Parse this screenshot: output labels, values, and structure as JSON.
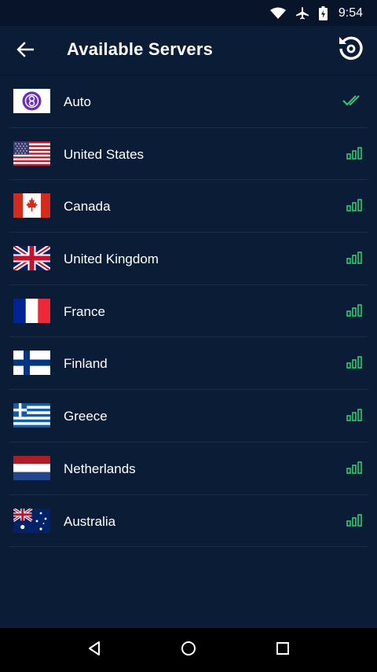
{
  "status_bar": {
    "time": "9:54",
    "icons": [
      "wifi-icon",
      "airplane-icon",
      "battery-icon"
    ]
  },
  "header": {
    "title": "Available Servers",
    "back_icon": "arrow-back-icon",
    "refresh_icon": "refresh-icon"
  },
  "colors": {
    "background": "#0b1c37",
    "status_bar": "#07142a",
    "divider": "#1a2c4b",
    "signal_green": "#2ecc71",
    "auto_badge": "#6b2fbd"
  },
  "servers": [
    {
      "name": "Auto",
      "flag": "auto",
      "indicator": "double-check-icon"
    },
    {
      "name": "United States",
      "flag": "us",
      "indicator": "signal-bars-icon"
    },
    {
      "name": "Canada",
      "flag": "ca",
      "indicator": "signal-bars-icon"
    },
    {
      "name": "United Kingdom",
      "flag": "gb",
      "indicator": "signal-bars-icon"
    },
    {
      "name": "France",
      "flag": "fr",
      "indicator": "signal-bars-icon"
    },
    {
      "name": "Finland",
      "flag": "fi",
      "indicator": "signal-bars-icon"
    },
    {
      "name": "Greece",
      "flag": "gr",
      "indicator": "signal-bars-icon"
    },
    {
      "name": "Netherlands",
      "flag": "nl",
      "indicator": "signal-bars-icon"
    },
    {
      "name": "Australia",
      "flag": "au",
      "indicator": "signal-bars-icon"
    }
  ],
  "nav_bar": {
    "icons": [
      "nav-back-icon",
      "nav-home-icon",
      "nav-recents-icon"
    ]
  }
}
